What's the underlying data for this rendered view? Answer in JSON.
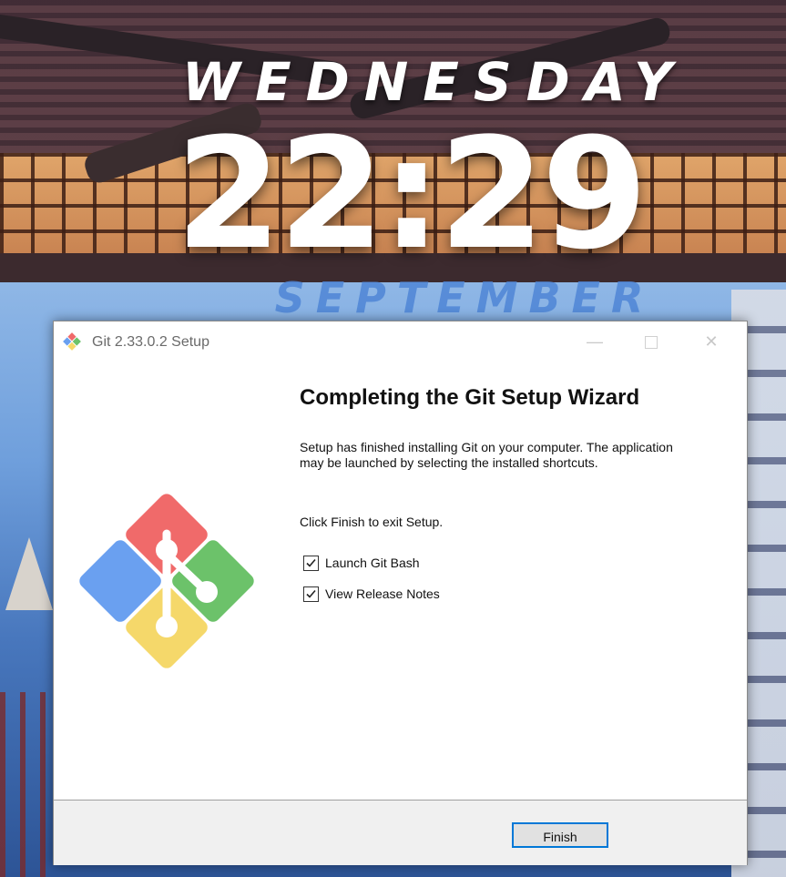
{
  "wallpaper": {
    "day": "WEDNESDAY",
    "time": "22:29",
    "month": "SEPTEMBER"
  },
  "window": {
    "title": "Git 2.33.0.2 Setup",
    "minimize_glyph": "—",
    "close_glyph": "✕"
  },
  "content": {
    "heading": "Completing the Git Setup Wizard",
    "paragraph1": "Setup has finished installing Git on your computer. The application may be launched by selecting the installed shortcuts.",
    "paragraph2": "Click Finish to exit Setup."
  },
  "options": [
    {
      "label": "Launch Git Bash",
      "checked": true
    },
    {
      "label": "View Release Notes",
      "checked": true
    }
  ],
  "footer": {
    "finish_label": "Finish"
  },
  "colors": {
    "accent": "#0078d7",
    "git_red": "#f06a6a",
    "git_green": "#6cc26a",
    "git_blue": "#6aa0f0",
    "git_yellow": "#f5d86a"
  },
  "icons": {
    "title_icon": "git-logo-icon",
    "logo": "git-logo-icon"
  }
}
